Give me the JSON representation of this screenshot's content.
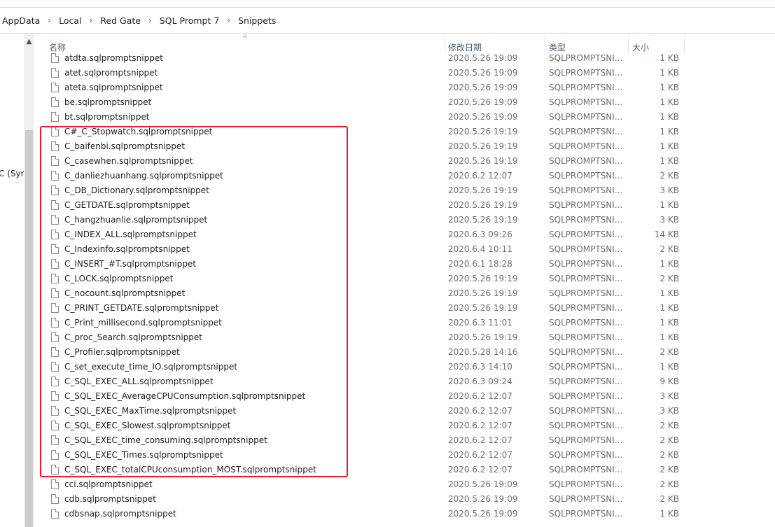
{
  "breadcrumb": [
    "AppData",
    "Local",
    "Red Gate",
    "SQL Prompt 7",
    "Snippets"
  ],
  "breadcrumb_separator": "›",
  "nav": {
    "partial_item": "C (Sym"
  },
  "columns": {
    "name": "名称",
    "date": "修改日期",
    "type": "类型",
    "size": "大小"
  },
  "files": [
    {
      "name": "atdta.sqlpromptsnippet",
      "date": "2020.5.26 19:09",
      "type": "SQLPROMPTSNI...",
      "size": "1 KB"
    },
    {
      "name": "atet.sqlpromptsnippet",
      "date": "2020.5.26 19:09",
      "type": "SQLPROMPTSNI...",
      "size": "1 KB"
    },
    {
      "name": "ateta.sqlpromptsnippet",
      "date": "2020.5.26 19:09",
      "type": "SQLPROMPTSNI...",
      "size": "1 KB"
    },
    {
      "name": "be.sqlpromptsnippet",
      "date": "2020.5.26 19:09",
      "type": "SQLPROMPTSNI...",
      "size": "1 KB"
    },
    {
      "name": "bt.sqlpromptsnippet",
      "date": "2020.5.26 19:09",
      "type": "SQLPROMPTSNI...",
      "size": "1 KB"
    },
    {
      "name": "C#_C_Stopwatch.sqlpromptsnippet",
      "date": "2020.5.26 19:19",
      "type": "SQLPROMPTSNI...",
      "size": "1 KB"
    },
    {
      "name": "C_baifenbi.sqlpromptsnippet",
      "date": "2020.5.26 19:19",
      "type": "SQLPROMPTSNI...",
      "size": "1 KB"
    },
    {
      "name": "C_casewhen.sqlpromptsnippet",
      "date": "2020.5.26 19:19",
      "type": "SQLPROMPTSNI...",
      "size": "1 KB"
    },
    {
      "name": "C_danliezhuanhang.sqlpromptsnippet",
      "date": "2020.6.2 12:07",
      "type": "SQLPROMPTSNI...",
      "size": "2 KB"
    },
    {
      "name": "C_DB_Dictionary.sqlpromptsnippet",
      "date": "2020.5.26 19:19",
      "type": "SQLPROMPTSNI...",
      "size": "3 KB"
    },
    {
      "name": "C_GETDATE.sqlpromptsnippet",
      "date": "2020.5.26 19:19",
      "type": "SQLPROMPTSNI...",
      "size": "1 KB"
    },
    {
      "name": "C_hangzhuanlie.sqlpromptsnippet",
      "date": "2020.5.26 19:19",
      "type": "SQLPROMPTSNI...",
      "size": "3 KB"
    },
    {
      "name": "C_INDEX_ALL.sqlpromptsnippet",
      "date": "2020.6.3 09:26",
      "type": "SQLPROMPTSNI...",
      "size": "14 KB"
    },
    {
      "name": "C_Indexinfo.sqlpromptsnippet",
      "date": "2020.6.4 10:11",
      "type": "SQLPROMPTSNI...",
      "size": "2 KB"
    },
    {
      "name": "C_INSERT_#T.sqlpromptsnippet",
      "date": "2020.6.1 18:28",
      "type": "SQLPROMPTSNI...",
      "size": "1 KB"
    },
    {
      "name": "C_LOCK.sqlpromptsnippet",
      "date": "2020.5.26 19:19",
      "type": "SQLPROMPTSNI...",
      "size": "2 KB"
    },
    {
      "name": "C_nocount.sqlpromptsnippet",
      "date": "2020.5.26 19:19",
      "type": "SQLPROMPTSNI...",
      "size": "1 KB"
    },
    {
      "name": "C_PRINT_GETDATE.sqlpromptsnippet",
      "date": "2020.5.26 19:19",
      "type": "SQLPROMPTSNI...",
      "size": "1 KB"
    },
    {
      "name": "C_Print_millisecond.sqlpromptsnippet",
      "date": "2020.6.3 11:01",
      "type": "SQLPROMPTSNI...",
      "size": "1 KB"
    },
    {
      "name": "C_proc_Search.sqlpromptsnippet",
      "date": "2020.5.26 19:19",
      "type": "SQLPROMPTSNI...",
      "size": "1 KB"
    },
    {
      "name": "C_Profiler.sqlpromptsnippet",
      "date": "2020.5.28 14:16",
      "type": "SQLPROMPTSNI...",
      "size": "2 KB"
    },
    {
      "name": "C_set_execute_time_IO.sqlpromptsnippet",
      "date": "2020.6.3 14:10",
      "type": "SQLPROMPTSNI...",
      "size": "1 KB"
    },
    {
      "name": "C_SQL_EXEC_ALL.sqlpromptsnippet",
      "date": "2020.6.3 09:24",
      "type": "SQLPROMPTSNI...",
      "size": "9 KB"
    },
    {
      "name": "C_SQL_EXEC_AverageCPUConsumption.sqlpromptsnippet",
      "date": "2020.6.2 12:07",
      "type": "SQLPROMPTSNI...",
      "size": "3 KB"
    },
    {
      "name": "C_SQL_EXEC_MaxTime.sqlpromptsnippet",
      "date": "2020.6.2 12:07",
      "type": "SQLPROMPTSNI...",
      "size": "3 KB"
    },
    {
      "name": "C_SQL_EXEC_Slowest.sqlpromptsnippet",
      "date": "2020.6.2 12:07",
      "type": "SQLPROMPTSNI...",
      "size": "2 KB"
    },
    {
      "name": "C_SQL_EXEC_time_consuming.sqlpromptsnippet",
      "date": "2020.6.2 12:07",
      "type": "SQLPROMPTSNI...",
      "size": "2 KB"
    },
    {
      "name": "C_SQL_EXEC_Times.sqlpromptsnippet",
      "date": "2020.6.2 12:07",
      "type": "SQLPROMPTSNI...",
      "size": "2 KB"
    },
    {
      "name": "C_SQL_EXEC_totalCPUconsumption_MOST.sqlpromptsnippet",
      "date": "2020.6.2 12:07",
      "type": "SQLPROMPTSNI...",
      "size": "2 KB"
    },
    {
      "name": "cci.sqlpromptsnippet",
      "date": "2020.5.26 19:09",
      "type": "SQLPROMPTSNI...",
      "size": "2 KB"
    },
    {
      "name": "cdb.sqlpromptsnippet",
      "date": "2020.5.26 19:09",
      "type": "SQLPROMPTSNI...",
      "size": "2 KB"
    },
    {
      "name": "cdbsnap.sqlpromptsnippet",
      "date": "2020.5.26 19:09",
      "type": "SQLPROMPTSNI...",
      "size": "1 KB"
    }
  ],
  "highlight_color": "#e0202a"
}
